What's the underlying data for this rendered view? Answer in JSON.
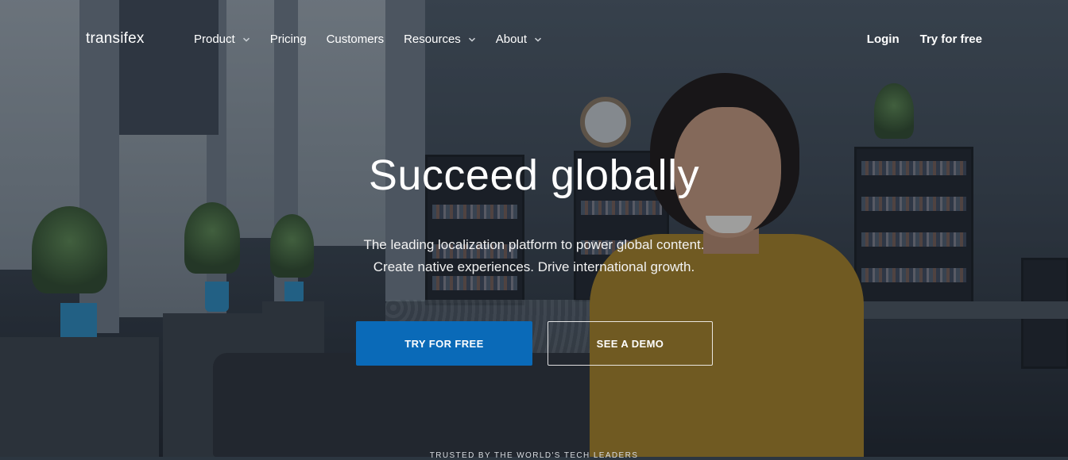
{
  "header": {
    "logo": "transifex",
    "nav": [
      {
        "label": "Product",
        "has_dropdown": true
      },
      {
        "label": "Pricing",
        "has_dropdown": false
      },
      {
        "label": "Customers",
        "has_dropdown": false
      },
      {
        "label": "Resources",
        "has_dropdown": true
      },
      {
        "label": "About",
        "has_dropdown": true
      }
    ],
    "login": "Login",
    "try_free": "Try for free"
  },
  "hero": {
    "title": "Succeed globally",
    "subtitle_line1": "The leading localization platform to power global content.",
    "subtitle_line2": "Create native experiences. Drive international growth.",
    "primary_button": "TRY FOR FREE",
    "secondary_button": "SEE A DEMO"
  },
  "trusted": "TRUSTED BY THE WORLD'S TECH LEADERS",
  "colors": {
    "primary_button": "#0a6ab8",
    "text": "#ffffff"
  },
  "icons": {
    "dropdown": "chevron-down-icon"
  }
}
